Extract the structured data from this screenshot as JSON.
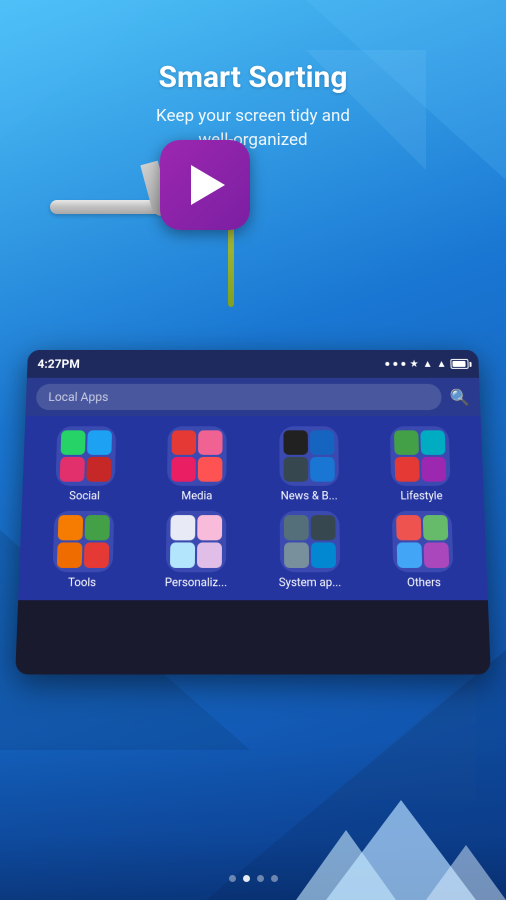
{
  "page": {
    "title": "Smart Sorting",
    "subtitle": "Keep your screen tidy and\nwell-organized",
    "bg_color_top": "#4fc3f7",
    "bg_color_bottom": "#0d47a1"
  },
  "status_bar": {
    "time": "4:27PM",
    "icons": "... ★ ⊕ ▲ ☁ ■"
  },
  "search_bar": {
    "placeholder": "Local Apps"
  },
  "folders": [
    {
      "id": "social",
      "label": "Social",
      "class": "social"
    },
    {
      "id": "media",
      "label": "Media",
      "class": "media"
    },
    {
      "id": "news",
      "label": "News & B...",
      "class": "news"
    },
    {
      "id": "lifestyle",
      "label": "Lifestyle",
      "class": "lifestyle"
    },
    {
      "id": "tools",
      "label": "Tools",
      "class": "tools"
    },
    {
      "id": "personalize",
      "label": "Personaliz...",
      "class": "personalize"
    },
    {
      "id": "systemapp",
      "label": "System ap...",
      "class": "systemapp"
    },
    {
      "id": "others",
      "label": "Others",
      "class": "others"
    }
  ],
  "dots": [
    {
      "active": false
    },
    {
      "active": true
    },
    {
      "active": false
    },
    {
      "active": false
    }
  ],
  "play_button": {
    "label": "▶"
  }
}
